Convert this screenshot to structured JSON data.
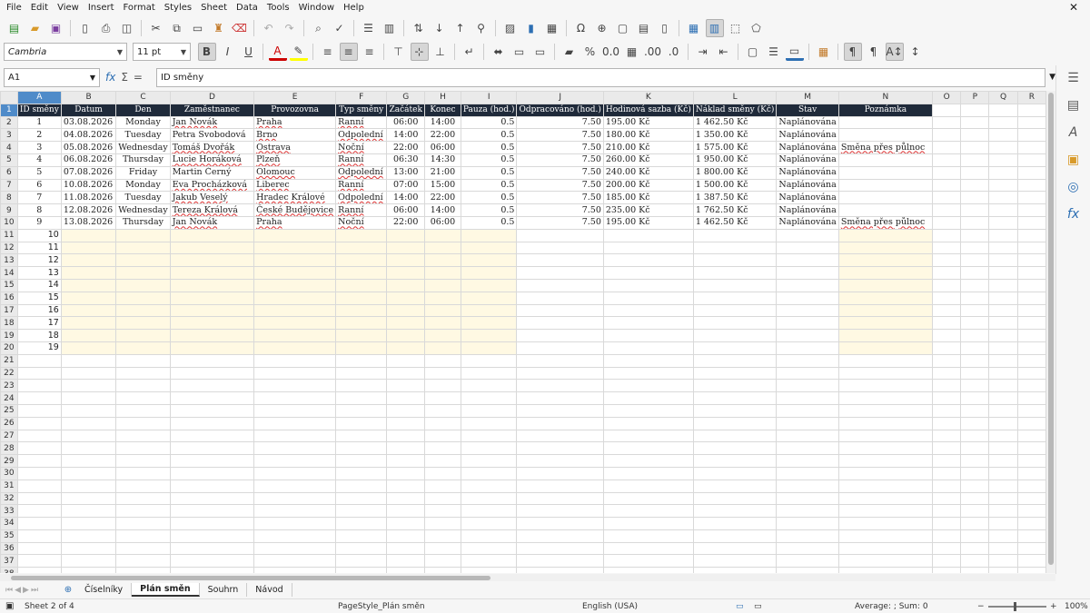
{
  "menu": [
    "File",
    "Edit",
    "View",
    "Insert",
    "Format",
    "Styles",
    "Sheet",
    "Data",
    "Tools",
    "Window",
    "Help"
  ],
  "font": {
    "name": "Cambria",
    "size": "11 pt"
  },
  "namebox": "A1",
  "formula": "ID směny",
  "columns": [
    "A",
    "B",
    "C",
    "D",
    "E",
    "F",
    "G",
    "H",
    "I",
    "J",
    "K",
    "L",
    "M",
    "N",
    "O",
    "P",
    "Q",
    "R"
  ],
  "headers": [
    "ID směny",
    "Datum",
    "Den",
    "Zaměstnanec",
    "Provozovna",
    "Typ směny",
    "Začátek",
    "Konec",
    "Pauza (hod.)",
    "Odpracováno (hod.)",
    "Hodinová sazba (Kč)",
    "Náklad směny (Kč)",
    "Stav",
    "Poznámka"
  ],
  "rows": [
    [
      "1",
      "03.08.2026",
      "Monday",
      "Jan Novák",
      "Praha",
      "Ranní",
      "06:00",
      "14:00",
      "0.5",
      "7.50",
      "195.00 Kč",
      "1 462.50 Kč",
      "Naplánována",
      ""
    ],
    [
      "2",
      "04.08.2026",
      "Tuesday",
      "Petra Svobodová",
      "Brno",
      "Odpolední",
      "14:00",
      "22:00",
      "0.5",
      "7.50",
      "180.00 Kč",
      "1 350.00 Kč",
      "Naplánována",
      ""
    ],
    [
      "3",
      "05.08.2026",
      "Wednesday",
      "Tomáš Dvořák",
      "Ostrava",
      "Noční",
      "22:00",
      "06:00",
      "0.5",
      "7.50",
      "210.00 Kč",
      "1 575.00 Kč",
      "Naplánována",
      "Směna přes půlnoc"
    ],
    [
      "4",
      "06.08.2026",
      "Thursday",
      "Lucie Horáková",
      "Plzeň",
      "Ranní",
      "06:30",
      "14:30",
      "0.5",
      "7.50",
      "260.00 Kč",
      "1 950.00 Kč",
      "Naplánována",
      ""
    ],
    [
      "5",
      "07.08.2026",
      "Friday",
      "Martin Černý",
      "Olomouc",
      "Odpolední",
      "13:00",
      "21:00",
      "0.5",
      "7.50",
      "240.00 Kč",
      "1 800.00 Kč",
      "Naplánována",
      ""
    ],
    [
      "6",
      "10.08.2026",
      "Monday",
      "Eva Procházková",
      "Liberec",
      "Ranní",
      "07:00",
      "15:00",
      "0.5",
      "7.50",
      "200.00 Kč",
      "1 500.00 Kč",
      "Naplánována",
      ""
    ],
    [
      "7",
      "11.08.2026",
      "Tuesday",
      "Jakub Veselý",
      "Hradec Králové",
      "Odpolední",
      "14:00",
      "22:00",
      "0.5",
      "7.50",
      "185.00 Kč",
      "1 387.50 Kč",
      "Naplánována",
      ""
    ],
    [
      "8",
      "12.08.2026",
      "Wednesday",
      "Tereza Králová",
      "České Budějovice",
      "Ranní",
      "06:00",
      "14:00",
      "0.5",
      "7.50",
      "235.00 Kč",
      "1 762.50 Kč",
      "Naplánována",
      ""
    ],
    [
      "9",
      "13.08.2026",
      "Thursday",
      "Jan Novák",
      "Praha",
      "Noční",
      "22:00",
      "06:00",
      "0.5",
      "7.50",
      "195.00 Kč",
      "1 462.50 Kč",
      "Naplánována",
      "Směna přes půlnoc"
    ]
  ],
  "extra_ids": [
    "10",
    "11",
    "12",
    "13",
    "14",
    "15",
    "16",
    "17",
    "18",
    "19"
  ],
  "tabs": [
    "Číselníky",
    "Plán směn",
    "Souhrn",
    "Návod"
  ],
  "active_tab": "Plán směn",
  "status": {
    "sheet": "Sheet 2 of 4",
    "pagestyle": "PageStyle_Plán směn",
    "language": "English (USA)",
    "sum": "Average: ; Sum: 0",
    "zoom": "100%",
    "zoom_minus": "−",
    "zoom_plus": "+"
  },
  "icons": {
    "close": "✕",
    "sidebar": [
      "menu-icon",
      "properties-icon",
      "styles-icon",
      "gallery-icon",
      "navigator-icon",
      "functions-icon"
    ]
  }
}
